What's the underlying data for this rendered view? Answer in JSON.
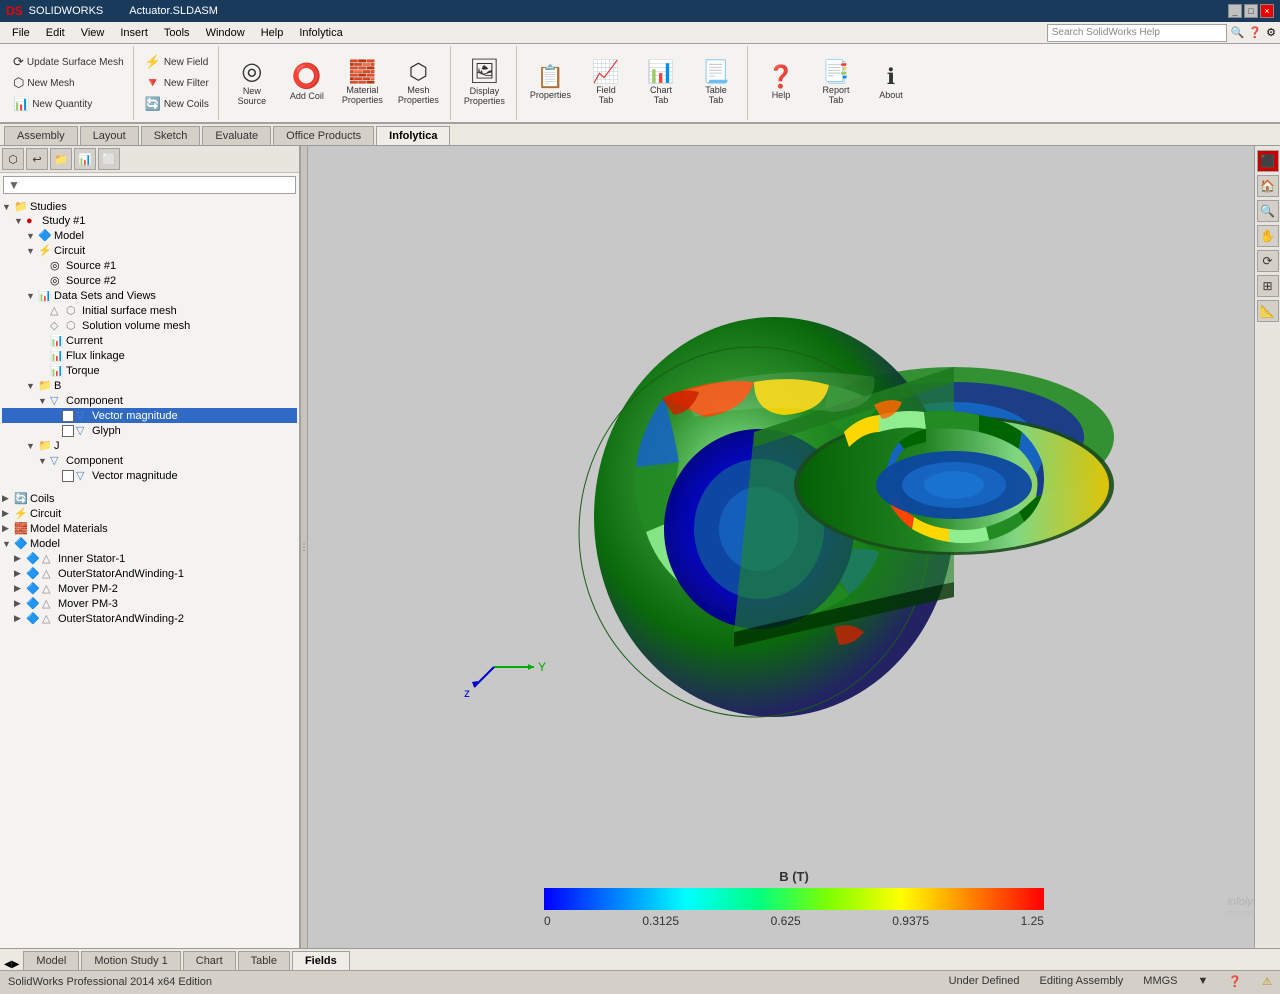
{
  "titleBar": {
    "appName": "DS SOLIDWORKS",
    "fileName": "Actuator.SLDASM",
    "windowControls": [
      "_",
      "□",
      "×"
    ]
  },
  "menuBar": {
    "items": [
      "File",
      "Edit",
      "View",
      "Insert",
      "Tools",
      "Window",
      "Help",
      "Infolytica"
    ]
  },
  "toolbar": {
    "groups": [
      {
        "name": "mesh-group",
        "buttons": [
          {
            "id": "update-surface-mesh",
            "label": "Update Surface Mesh",
            "icon": "⟳",
            "size": "small"
          },
          {
            "id": "new-mesh",
            "label": "New Mesh",
            "icon": "⬡",
            "size": "small"
          },
          {
            "id": "new-quantity",
            "label": "New Quantity",
            "icon": "📊",
            "size": "small"
          }
        ]
      },
      {
        "name": "new-group",
        "buttons": [
          {
            "id": "new-field",
            "label": "New Field",
            "icon": "⚡",
            "size": "small"
          },
          {
            "id": "new-filter",
            "label": "New Filter",
            "icon": "🔻",
            "size": "small"
          },
          {
            "id": "new-coils",
            "label": "New Coils",
            "icon": "🔄",
            "size": "small"
          }
        ]
      },
      {
        "name": "actions-group",
        "buttons": [
          {
            "id": "new-source",
            "label": "New Source",
            "icon": "◎",
            "size": "large"
          },
          {
            "id": "add-coil",
            "label": "Add Coil",
            "icon": "⭕",
            "size": "large"
          },
          {
            "id": "material-properties",
            "label": "Material Properties",
            "icon": "🧱",
            "size": "large"
          },
          {
            "id": "mesh-properties",
            "label": "Mesh Properties",
            "icon": "⬡",
            "size": "large"
          }
        ]
      },
      {
        "name": "display-group",
        "buttons": [
          {
            "id": "display-properties",
            "label": "Display Properties",
            "icon": "🖼",
            "size": "large"
          }
        ]
      },
      {
        "name": "view-group",
        "buttons": [
          {
            "id": "properties",
            "label": "Properties",
            "icon": "📋",
            "size": "large"
          },
          {
            "id": "field-tab",
            "label": "Field Tab",
            "icon": "📈",
            "size": "large"
          },
          {
            "id": "chart-tab",
            "label": "Chart Tab",
            "icon": "📊",
            "size": "large"
          },
          {
            "id": "table-tab",
            "label": "Table Tab",
            "icon": "📃",
            "size": "large"
          }
        ]
      },
      {
        "name": "help-group",
        "buttons": [
          {
            "id": "help",
            "label": "Help",
            "icon": "❓",
            "size": "large"
          },
          {
            "id": "report-tab",
            "label": "Report Tab",
            "icon": "📑",
            "size": "large"
          },
          {
            "id": "about",
            "label": "About",
            "icon": "ℹ",
            "size": "large"
          }
        ]
      }
    ]
  },
  "tabBar": {
    "tabs": [
      {
        "id": "assembly",
        "label": "Assembly",
        "active": false
      },
      {
        "id": "layout",
        "label": "Layout",
        "active": false
      },
      {
        "id": "sketch",
        "label": "Sketch",
        "active": false
      },
      {
        "id": "evaluate",
        "label": "Evaluate",
        "active": false
      },
      {
        "id": "office-products",
        "label": "Office Products",
        "active": false
      },
      {
        "id": "infolytica",
        "label": "Infolytica",
        "active": true
      }
    ]
  },
  "sidebar": {
    "searchPlaceholder": "",
    "tree": [
      {
        "id": "studies",
        "label": "Studies",
        "indent": 0,
        "icon": "📁",
        "expand": "▼",
        "type": "folder"
      },
      {
        "id": "study1",
        "label": "Study #1",
        "indent": 1,
        "icon": "●",
        "expand": "▼",
        "type": "item"
      },
      {
        "id": "model",
        "label": "Model",
        "indent": 2,
        "icon": "🔷",
        "expand": "▼",
        "type": "item"
      },
      {
        "id": "circuit",
        "label": "Circuit",
        "indent": 2,
        "icon": "⚡",
        "expand": "▼",
        "type": "item"
      },
      {
        "id": "source1",
        "label": "Source #1",
        "indent": 3,
        "icon": "◎",
        "type": "leaf"
      },
      {
        "id": "source2",
        "label": "Source #2",
        "indent": 3,
        "icon": "◎",
        "type": "leaf"
      },
      {
        "id": "datasets",
        "label": "Data Sets and Views",
        "indent": 2,
        "icon": "📊",
        "expand": "▼",
        "type": "folder"
      },
      {
        "id": "initial-surface",
        "label": "Initial surface mesh",
        "indent": 3,
        "icon": "⬡",
        "type": "leaf"
      },
      {
        "id": "solution-volume",
        "label": "Solution volume mesh",
        "indent": 3,
        "icon": "⬡",
        "type": "leaf"
      },
      {
        "id": "current",
        "label": "Current",
        "indent": 3,
        "icon": "📊",
        "type": "leaf"
      },
      {
        "id": "flux-linkage",
        "label": "Flux linkage",
        "indent": 3,
        "icon": "📊",
        "type": "leaf"
      },
      {
        "id": "torque",
        "label": "Torque",
        "indent": 3,
        "icon": "📊",
        "type": "leaf"
      },
      {
        "id": "B",
        "label": "B",
        "indent": 2,
        "icon": "📁",
        "expand": "▼",
        "type": "folder"
      },
      {
        "id": "component-b",
        "label": "Component",
        "indent": 3,
        "icon": "🔻",
        "expand": "▼",
        "type": "folder"
      },
      {
        "id": "vector-magnitude",
        "label": "Vector magnitude",
        "indent": 4,
        "icon": "🔻",
        "type": "leaf",
        "selected": true,
        "checked": true
      },
      {
        "id": "glyph",
        "label": "Glyph",
        "indent": 4,
        "icon": "🔻",
        "type": "leaf",
        "checked": false
      },
      {
        "id": "J",
        "label": "J",
        "indent": 2,
        "icon": "📁",
        "expand": "▼",
        "type": "folder"
      },
      {
        "id": "component-j",
        "label": "Component",
        "indent": 3,
        "icon": "🔻",
        "expand": "▼",
        "type": "folder"
      },
      {
        "id": "vector-magnitude-j",
        "label": "Vector magnitude",
        "indent": 4,
        "icon": "🔻",
        "type": "leaf",
        "checked": false
      }
    ],
    "bottomItems": [
      {
        "id": "coils",
        "label": "Coils",
        "indent": 0,
        "icon": "🔄",
        "expand": "▶"
      },
      {
        "id": "circuit-b",
        "label": "Circuit",
        "indent": 0,
        "icon": "⚡",
        "expand": "▶"
      },
      {
        "id": "model-materials",
        "label": "Model Materials",
        "indent": 0,
        "icon": "🧱",
        "expand": "▶"
      },
      {
        "id": "model-bottom",
        "label": "Model",
        "indent": 0,
        "icon": "🔷",
        "expand": "▼"
      },
      {
        "id": "inner-stator",
        "label": "Inner Stator-1",
        "indent": 1,
        "icon": "🔷",
        "expand": "▶"
      },
      {
        "id": "outer-stator-1",
        "label": "OuterStatorAndWinding-1",
        "indent": 1,
        "icon": "⚠",
        "expand": "▶"
      },
      {
        "id": "mover-pm2",
        "label": "Mover PM-2",
        "indent": 1,
        "icon": "🔷",
        "expand": "▶"
      },
      {
        "id": "mover-pm3",
        "label": "Mover PM-3",
        "indent": 1,
        "icon": "⚠",
        "expand": "▶"
      },
      {
        "id": "outer-stator-2",
        "label": "OuterStatorAndWinding-2",
        "indent": 1,
        "icon": "⚠",
        "expand": "▶"
      }
    ]
  },
  "colorLegend": {
    "title": "B (T)",
    "min": "0",
    "v1": "0.3125",
    "v2": "0.625",
    "v3": "0.9375",
    "max": "1.25"
  },
  "bottomTabs": {
    "tabs": [
      {
        "id": "model-tab",
        "label": "Model",
        "active": false
      },
      {
        "id": "motion-study",
        "label": "Motion Study 1",
        "active": false
      },
      {
        "id": "chart",
        "label": "Chart",
        "active": false
      },
      {
        "id": "table",
        "label": "Table",
        "active": false
      },
      {
        "id": "fields",
        "label": "Fields",
        "active": true
      }
    ]
  },
  "statusBar": {
    "left": "SolidWorks Professional 2014 x64 Edition",
    "status": "Under Defined",
    "mode": "Editing Assembly",
    "units": "MMGS"
  },
  "rightToolbar": {
    "buttons": [
      "🔎",
      "⟳",
      "🏠",
      "📐",
      "⊞",
      "🔷",
      "📌"
    ]
  }
}
